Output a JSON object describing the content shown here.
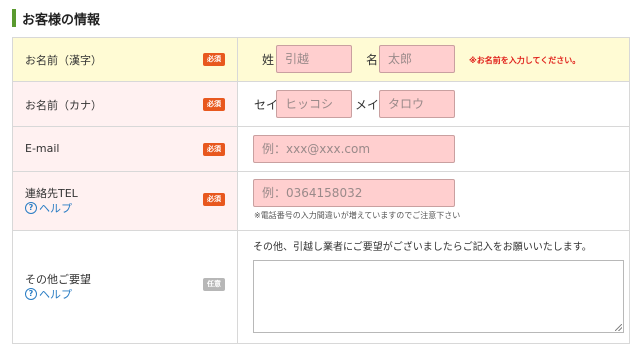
{
  "section_title": "お客様の情報",
  "badges": {
    "required": "必須",
    "optional": "任意"
  },
  "help_text": "ヘルプ",
  "rows": {
    "name_kanji": {
      "label": "お名前（漢字）",
      "last_prefix": "姓",
      "last_value": "引越",
      "first_prefix": "名",
      "first_value": "太郎",
      "error": "※お名前を入力してください。"
    },
    "name_kana": {
      "label": "お名前（カナ）",
      "last_prefix": "セイ",
      "last_value": "ヒッコシ",
      "first_prefix": "メイ",
      "first_value": "タロウ"
    },
    "email": {
      "label": "E-mail",
      "placeholder": "例：xxx@xxx.com"
    },
    "tel": {
      "label": "連絡先TEL",
      "placeholder": "例：0364158032",
      "note": "※電話番号の入力間違いが増えていますのでご注意下さい"
    },
    "request": {
      "label": "その他ご要望",
      "description": "その他、引越し業者にご要望がございましたらご記入をお願いいたします。",
      "value": ""
    }
  },
  "colors": {
    "accent": "#5a9a2f",
    "required_badge": "#e8581e",
    "optional_badge": "#b7b7b7",
    "input_error_bg": "#ffcfcf",
    "error_text": "#e0201a",
    "highlight_row": "#fffbd4",
    "label_bg": "#fff1f1",
    "help_link": "#2a7dc4"
  }
}
